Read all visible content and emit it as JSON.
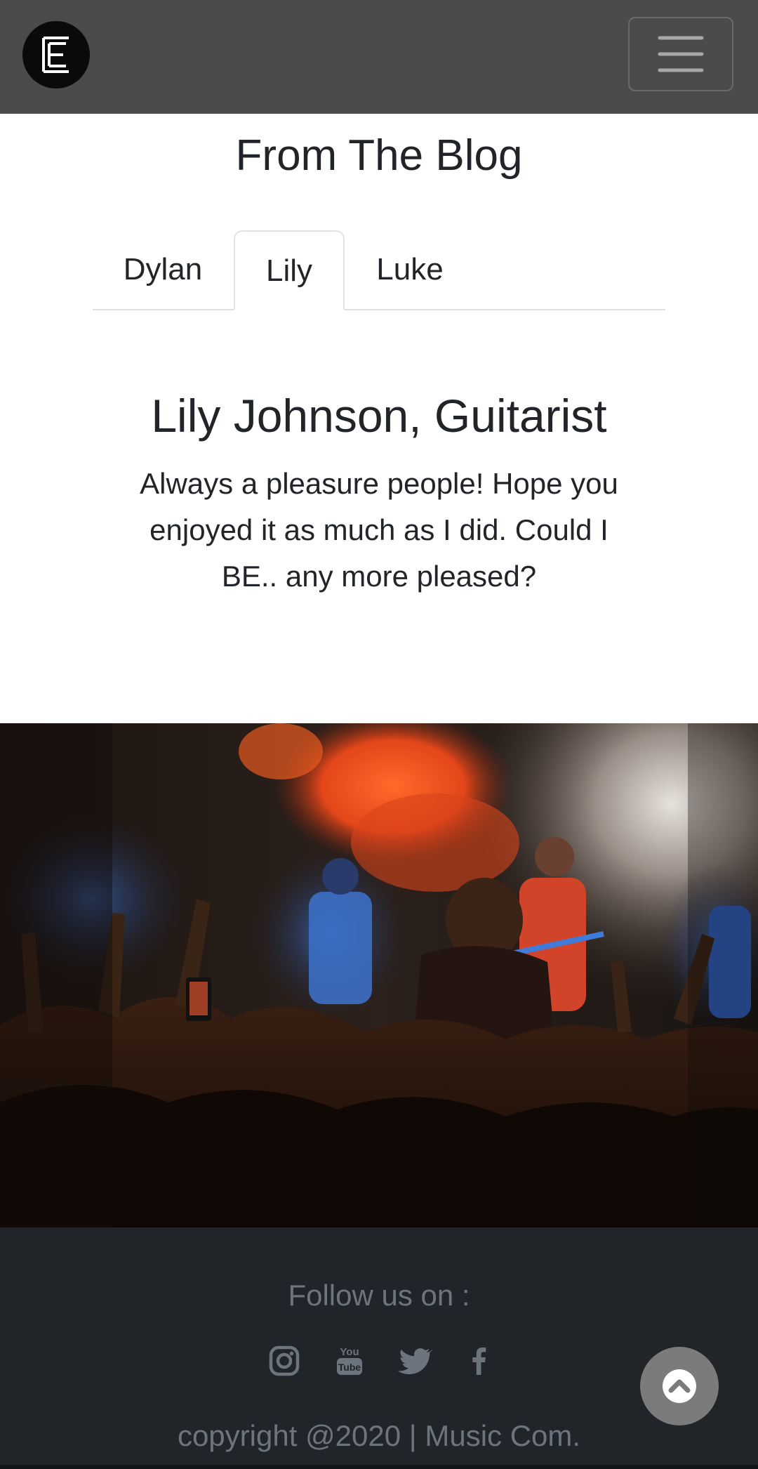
{
  "navbar": {
    "logo_icon": "logo-e-icon",
    "menu_icon": "hamburger-icon",
    "background": "#4b4b4b"
  },
  "blog": {
    "heading": "From The Blog",
    "tabs": [
      {
        "label": "Dylan",
        "active": false
      },
      {
        "label": "Lily",
        "active": true
      },
      {
        "label": "Luke",
        "active": false
      }
    ],
    "post": {
      "title": "Lily Johnson, Guitarist",
      "body": "Always a pleasure people! Hope you enjoyed it as much as I did. Could I BE.. any more pleased?"
    }
  },
  "hero": {
    "image": "concert-crowd-photo"
  },
  "footer": {
    "follow_label": "Follow us on :",
    "social": [
      "instagram-icon",
      "youtube-icon",
      "twitter-icon",
      "facebook-icon"
    ],
    "copyright": "copyright @2020 | Music Com.",
    "background": "#212529",
    "text_color": "#6c757d"
  },
  "back_to_top": {
    "icon": "chevron-up-circle-icon"
  }
}
